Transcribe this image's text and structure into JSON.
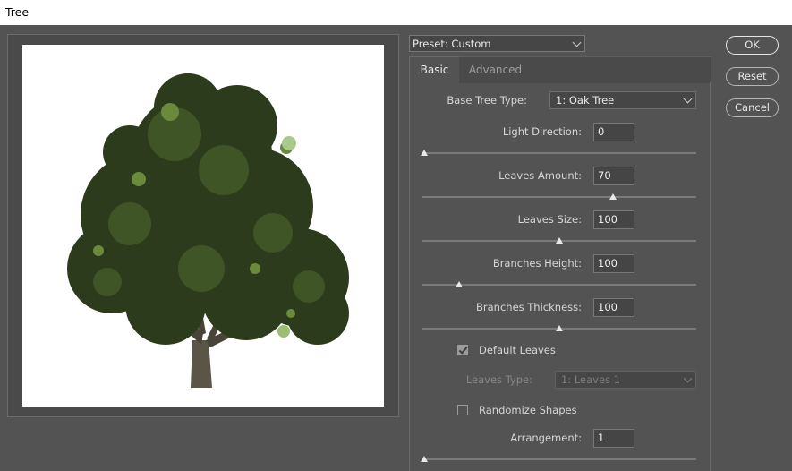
{
  "window": {
    "title": "Tree"
  },
  "preset": {
    "label": "Preset:",
    "value": "Custom",
    "display": "Preset: Custom"
  },
  "tabs": [
    {
      "label": "Basic",
      "active": true
    },
    {
      "label": "Advanced",
      "active": false
    }
  ],
  "base_tree_type": {
    "label": "Base Tree Type:",
    "value": "1: Oak Tree"
  },
  "sliders": [
    {
      "id": "light-direction",
      "label": "Light Direction:",
      "value": "0",
      "thumb_fraction": 0.0
    },
    {
      "id": "leaves-amount",
      "label": "Leaves Amount:",
      "value": "70",
      "thumb_fraction": 0.7
    },
    {
      "id": "leaves-size",
      "label": "Leaves Size:",
      "value": "100",
      "thumb_fraction": 0.5
    },
    {
      "id": "branches-height",
      "label": "Branches Height:",
      "value": "100",
      "thumb_fraction": 0.13
    },
    {
      "id": "branches-thickness",
      "label": "Branches Thickness:",
      "value": "100",
      "thumb_fraction": 0.5
    },
    {
      "id": "arrangement",
      "label": "Arrangement:",
      "value": "1",
      "thumb_fraction": 0.0
    }
  ],
  "default_leaves": {
    "label": "Default Leaves",
    "checked": true
  },
  "leaves_type": {
    "label": "Leaves Type:",
    "value": "1: Leaves 1",
    "disabled": true
  },
  "randomize_shapes": {
    "label": "Randomize Shapes",
    "checked": false
  },
  "buttons": {
    "ok": "OK",
    "reset": "Reset",
    "cancel": "Cancel"
  },
  "colors": {
    "dialog_bg": "#535353",
    "preview_bg": "#ffffff",
    "foliage": "#2e3f1f",
    "trunk": "#5b5548"
  }
}
